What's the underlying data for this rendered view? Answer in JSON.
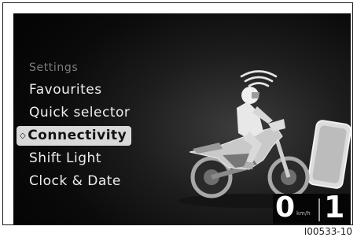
{
  "menu": {
    "title": "Settings",
    "items": [
      {
        "label": "Favourites",
        "selected": false
      },
      {
        "label": "Quick selector",
        "selected": false
      },
      {
        "label": "Connectivity",
        "selected": true
      },
      {
        "label": "Shift Light",
        "selected": false
      },
      {
        "label": "Clock & Date",
        "selected": false
      }
    ],
    "selection_marker": "◇"
  },
  "status": {
    "speed": "0",
    "speed_unit": "km/h",
    "gear": "1"
  },
  "figure_id": "I00533-10",
  "icons": [
    "wireless-signal-icon",
    "smartphone-icon",
    "rider-motorcycle-illustration"
  ],
  "colors": {
    "screen_bg": "#0b0b0b",
    "menu_text": "#eeeeee",
    "menu_title": "#7d7d7d",
    "selected_bg": "#d9d9d9",
    "selected_text": "#111111"
  }
}
